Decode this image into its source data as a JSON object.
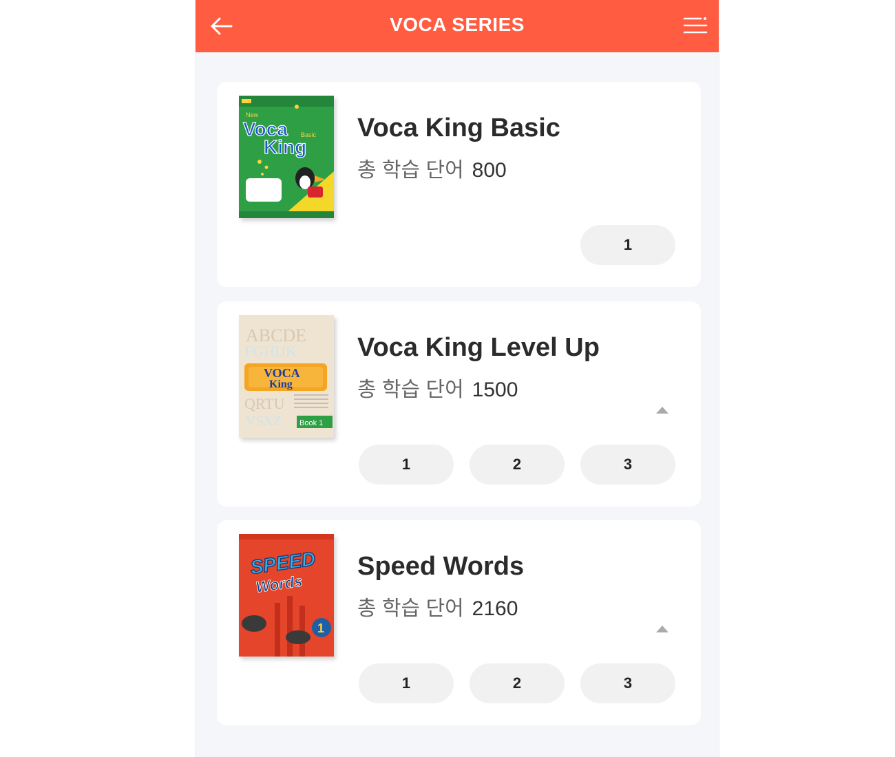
{
  "header": {
    "title": "VOCA SERIES",
    "back_icon": "arrow-left-icon",
    "menu_icon": "menu-icon",
    "color": "#ff5c41"
  },
  "books": [
    {
      "title": "Voca King Basic",
      "word_label": "총 학습 단어",
      "word_count": "800",
      "levels": [
        "1"
      ],
      "cover": {
        "line1": "New",
        "line2": "Voca",
        "line3": "King",
        "badge": "Basic",
        "color": "#2e9f45"
      }
    },
    {
      "title": "Voca King Level Up",
      "word_label": "총 학습 단어",
      "word_count": "1500",
      "levels": [
        "1",
        "2",
        "3"
      ],
      "cover": {
        "line1": "VOCA",
        "line2": "King",
        "badge": "Book 1",
        "color": "#efe4d2"
      }
    },
    {
      "title": "Speed Words",
      "word_label": "총 학습 단어",
      "word_count": "2160",
      "levels": [
        "1",
        "2",
        "3"
      ],
      "cover": {
        "line1": "SPEED",
        "line2": "Words",
        "badge": "1",
        "color": "#e5452a"
      }
    }
  ],
  "colors": {
    "accent": "#ff5c41",
    "background": "#f5f6fa",
    "card": "#ffffff",
    "pill": "#f1f1f1"
  }
}
